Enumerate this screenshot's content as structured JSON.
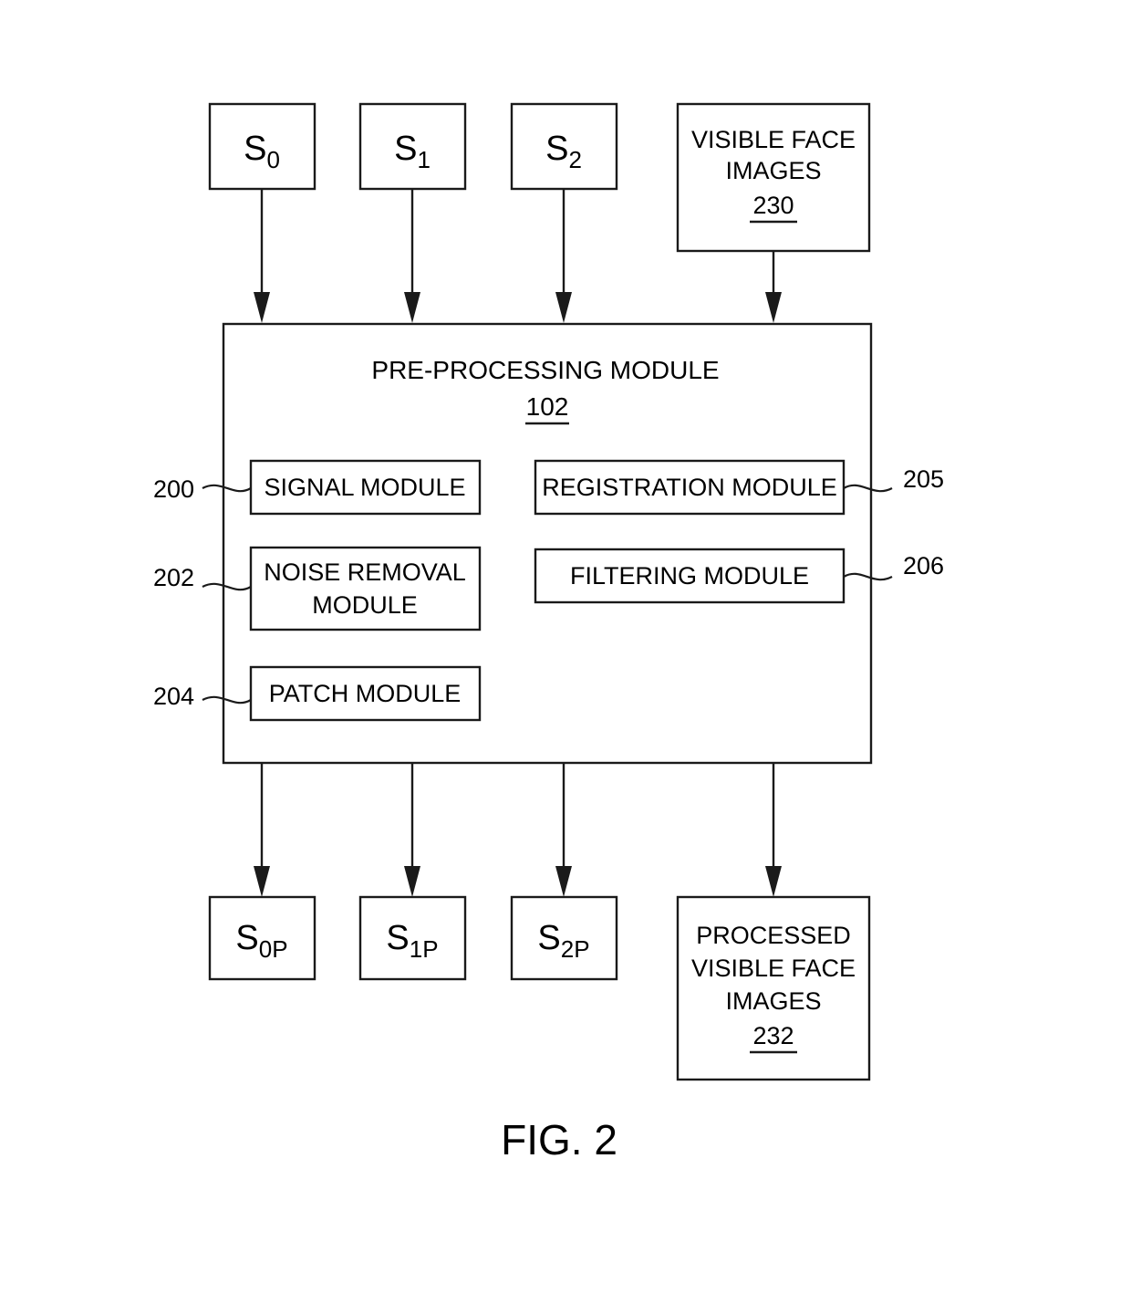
{
  "figure": {
    "caption": "FIG. 2"
  },
  "inputs": [
    {
      "name": "signal-0",
      "base": "S",
      "sub": "0"
    },
    {
      "name": "signal-1",
      "base": "S",
      "sub": "1"
    },
    {
      "name": "signal-2",
      "base": "S",
      "sub": "2"
    }
  ],
  "input_image_box": {
    "line1": "VISIBLE FACE",
    "line2": "IMAGES",
    "ref": "230"
  },
  "main_module": {
    "title": "PRE-PROCESSING MODULE",
    "ref": "102",
    "left_column": [
      {
        "label_line1": "SIGNAL MODULE",
        "label_line2": "",
        "ref": "200"
      },
      {
        "label_line1": "NOISE REMOVAL",
        "label_line2": "MODULE",
        "ref": "202"
      },
      {
        "label_line1": "PATCH MODULE",
        "label_line2": "",
        "ref": "204"
      }
    ],
    "right_column": [
      {
        "label_line1": "REGISTRATION MODULE",
        "label_line2": "",
        "ref": "205"
      },
      {
        "label_line1": "FILTERING MODULE",
        "label_line2": "",
        "ref": "206"
      }
    ]
  },
  "outputs": [
    {
      "name": "signal-0-processed",
      "base": "S",
      "sub": "0P"
    },
    {
      "name": "signal-1-processed",
      "base": "S",
      "sub": "1P"
    },
    {
      "name": "signal-2-processed",
      "base": "S",
      "sub": "2P"
    }
  ],
  "output_image_box": {
    "line1": "PROCESSED",
    "line2": "VISIBLE FACE",
    "line3": "IMAGES",
    "ref": "232"
  },
  "colors": {
    "stroke": "#1a1a1a",
    "fill": "#ffffff",
    "text": "#000000"
  }
}
